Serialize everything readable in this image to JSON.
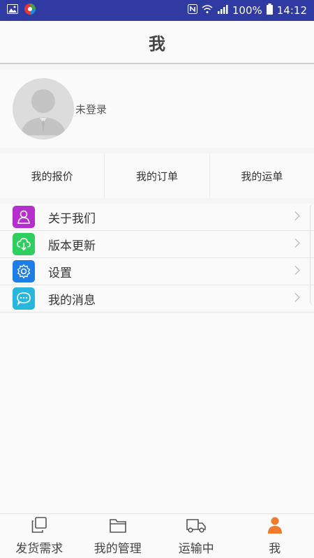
{
  "status_bar": {
    "battery": "100%",
    "time": "14:12"
  },
  "header": {
    "title": "我"
  },
  "profile": {
    "login_status": "未登录"
  },
  "quick_tabs": [
    {
      "label": "我的报价"
    },
    {
      "label": "我的订单"
    },
    {
      "label": "我的运单"
    }
  ],
  "menu": [
    {
      "label": "关于我们",
      "icon": "user-icon",
      "color": "#b72ecf"
    },
    {
      "label": "版本更新",
      "icon": "cloud-download-icon",
      "color": "#2fcf5f"
    },
    {
      "label": "设置",
      "icon": "gear-icon",
      "color": "#1f7de6"
    },
    {
      "label": "我的消息",
      "icon": "chat-icon",
      "color": "#27b7de"
    }
  ],
  "tab_bar": [
    {
      "label": "发货需求",
      "icon": "copy-icon"
    },
    {
      "label": "我的管理",
      "icon": "folder-icon"
    },
    {
      "label": "运输中",
      "icon": "truck-icon"
    },
    {
      "label": "我",
      "icon": "person-icon",
      "active": true,
      "active_color": "#f07a2e"
    }
  ]
}
